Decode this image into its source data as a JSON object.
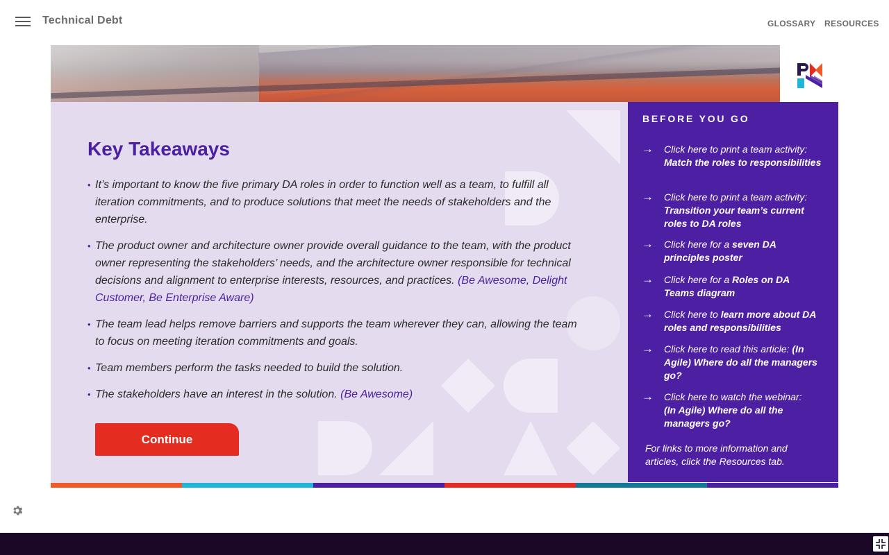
{
  "app": {
    "title": "Technical Debt"
  },
  "nav": {
    "glossary": "GLOSSARY",
    "resources": "RESOURCES"
  },
  "logo": {
    "text": "PMI"
  },
  "main": {
    "heading": "Key Takeaways",
    "items": [
      {
        "text": "It’s important to know the five primary DA roles in order to function well as a team, to fulfill all iteration commitments, and to produce solutions that meet the needs of stakeholders and the enterprise.",
        "ref": ""
      },
      {
        "text": "The product owner and architecture owner provide overall guidance to the team, with the product owner representing the stakeholders’ needs, and the architecture owner responsible for technical decisions and alignment to enterprise interests, resources, and practices.",
        "ref": "(Be Awesome, Delight Customer, Be Enterprise Aware)"
      },
      {
        "text": "The team lead helps remove barriers and supports the team wherever they can, allowing the team to focus on meeting iteration commitments and goals.",
        "ref": ""
      },
      {
        "text": "Team members perform the tasks needed to build the solution.",
        "ref": ""
      },
      {
        "text": "The stakeholders have an interest in the solution.",
        "ref": "(Be Awesome)"
      }
    ],
    "continue_label": "Continue"
  },
  "side": {
    "title": "BEFORE YOU GO",
    "links": [
      {
        "prefix": "Click here to print a team activity:",
        "bold": "Match the roles to responsibilities",
        "suffix": ""
      },
      {
        "prefix": "Click here to print a team activity:",
        "bold": "Transition your team’s current roles to DA roles",
        "suffix": ""
      },
      {
        "prefix": "Click here for a",
        "bold": "seven DA principles poster",
        "suffix": ""
      },
      {
        "prefix": "Click here for a",
        "bold": "Roles on DA Teams diagram",
        "suffix": ""
      },
      {
        "prefix": "Click here to",
        "bold": "learn more about DA roles and responsibilities",
        "suffix": ""
      },
      {
        "prefix": "Click here to read this article:",
        "bold": "(In Agile) Where do all the managers go?",
        "suffix": ""
      },
      {
        "prefix": "Click here to watch the webinar:",
        "bold": "(In Agile) Where do all the managers go?",
        "suffix": ""
      }
    ],
    "note": "For links to more information and articles, click the Resources tab."
  },
  "colors": {
    "accent_purple": "#4d1fa3",
    "panel_lavender": "#e4dbef",
    "button_red": "#e42d20",
    "strip": [
      "#f05a28",
      "#1fb6d9",
      "#4d1fa3",
      "#e42d20",
      "#127a96",
      "#4d1fa3"
    ]
  },
  "icons": {
    "menu": "hamburger-icon",
    "settings": "gear-icon",
    "arrow": "arrow-right-icon",
    "exit_fullscreen": "exit-fullscreen-icon"
  }
}
